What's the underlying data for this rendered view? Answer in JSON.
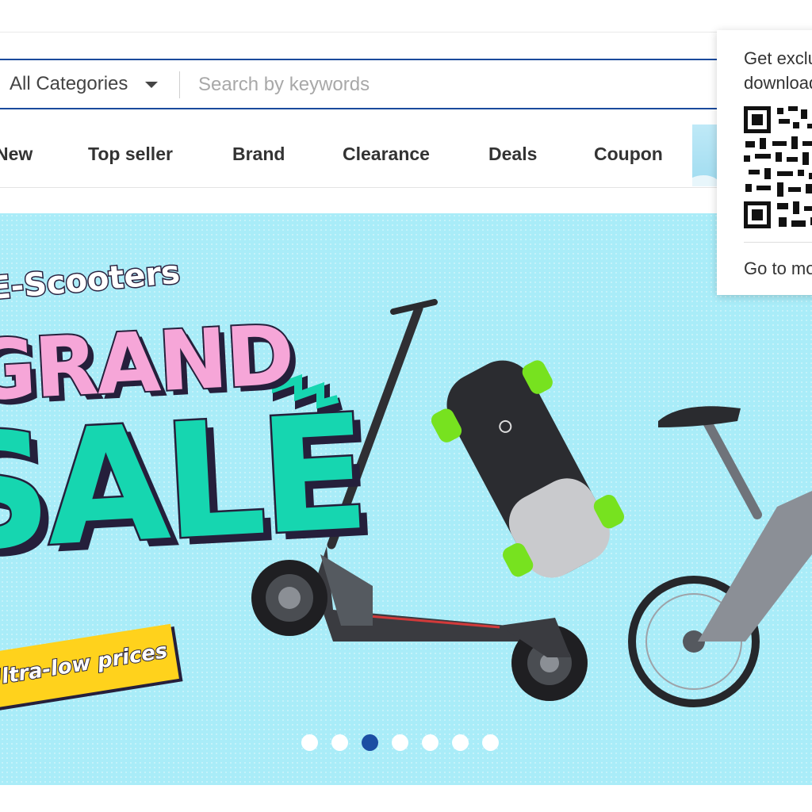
{
  "search": {
    "category_label": "All Categories",
    "placeholder": "Search by keywords"
  },
  "nav": {
    "items": [
      "New",
      "Top seller",
      "Brand",
      "Clearance",
      "Deals",
      "Coupon"
    ]
  },
  "banner": {
    "subhead": "E-Scooters",
    "headline_line1": "GRAND",
    "headline_line2": "SALE",
    "tagline": "Ultra-low prices",
    "carousel_slide_count": 7,
    "carousel_active_index": 2
  },
  "app_popup": {
    "line1": "Get exclusive offers",
    "line2": "download the app",
    "link": "Go to mobile site"
  },
  "colors": {
    "accent_blue": "#1a4a9c",
    "banner_bg": "#a9ecf8",
    "headline_pink": "#f6a6d8",
    "headline_teal": "#16d6b0",
    "tagline_yellow": "#ffd21c"
  }
}
